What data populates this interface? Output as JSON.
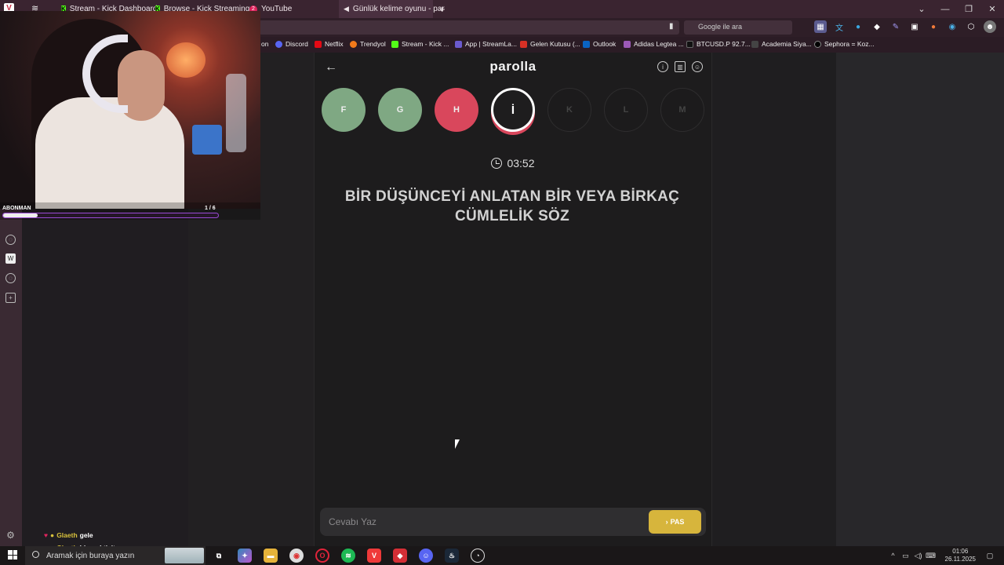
{
  "browser": {
    "tabs": [
      {
        "label": "Stream - Kick Dashboard"
      },
      {
        "label": "Browse - Kick Streaming"
      },
      {
        "label": "YouTube",
        "badge": "2"
      },
      {
        "label": "Günlük kelime oyunu - par"
      }
    ],
    "new_tab": "+",
    "search_placeholder": "Google ile ara",
    "bookmarks": [
      {
        "label": "on",
        "color": "#00000000"
      },
      {
        "label": "Discord",
        "color": "#5865f2"
      },
      {
        "label": "Netflix",
        "color": "#e50914"
      },
      {
        "label": "Trendyol",
        "color": "#f27a1a"
      },
      {
        "label": "Stream - Kick ...",
        "color": "#53fc18"
      },
      {
        "label": "App | StreamLa...",
        "color": "#6a5acd"
      },
      {
        "label": "Gelen Kutusu (...",
        "color": "#d93025"
      },
      {
        "label": "Outlook",
        "color": "#0a64c2"
      },
      {
        "label": "Adidas Legtea ...",
        "color": "#9b59b6"
      },
      {
        "label": "BTCUSD.P 92.7...",
        "color": "#111111"
      },
      {
        "label": "Academia Siya...",
        "color": "#444444"
      },
      {
        "label": "Sephora = Koz...",
        "color": "#000000"
      }
    ]
  },
  "overlay": {
    "sub_label": "ABONMAN",
    "sub_count": "1 / 6",
    "sub_progress": 0.16
  },
  "chat": {
    "messages": [
      {
        "user": "Glaeth",
        "text": "gele"
      },
      {
        "user": "Glaeth",
        "text": "hiperaktivite"
      }
    ]
  },
  "game": {
    "logo": "parolla",
    "letters": [
      {
        "char": "F",
        "state": "correct"
      },
      {
        "char": "G",
        "state": "correct"
      },
      {
        "char": "H",
        "state": "wrong"
      },
      {
        "char": "İ",
        "state": "current"
      },
      {
        "char": "K",
        "state": "pending"
      },
      {
        "char": "L",
        "state": "pending"
      },
      {
        "char": "M",
        "state": "pending"
      }
    ],
    "timer": "03:52",
    "question": "BİR DÜŞÜNCEYİ ANLATAN BİR VEYA BİRKAÇ CÜMLELİK SÖZ",
    "answer_placeholder": "Cevabı Yaz",
    "answer_value": "",
    "pass_label": "PAS"
  },
  "taskbar": {
    "search_placeholder": "Aramak için buraya yazın",
    "time": "01:06",
    "date": "26.11.2025"
  }
}
